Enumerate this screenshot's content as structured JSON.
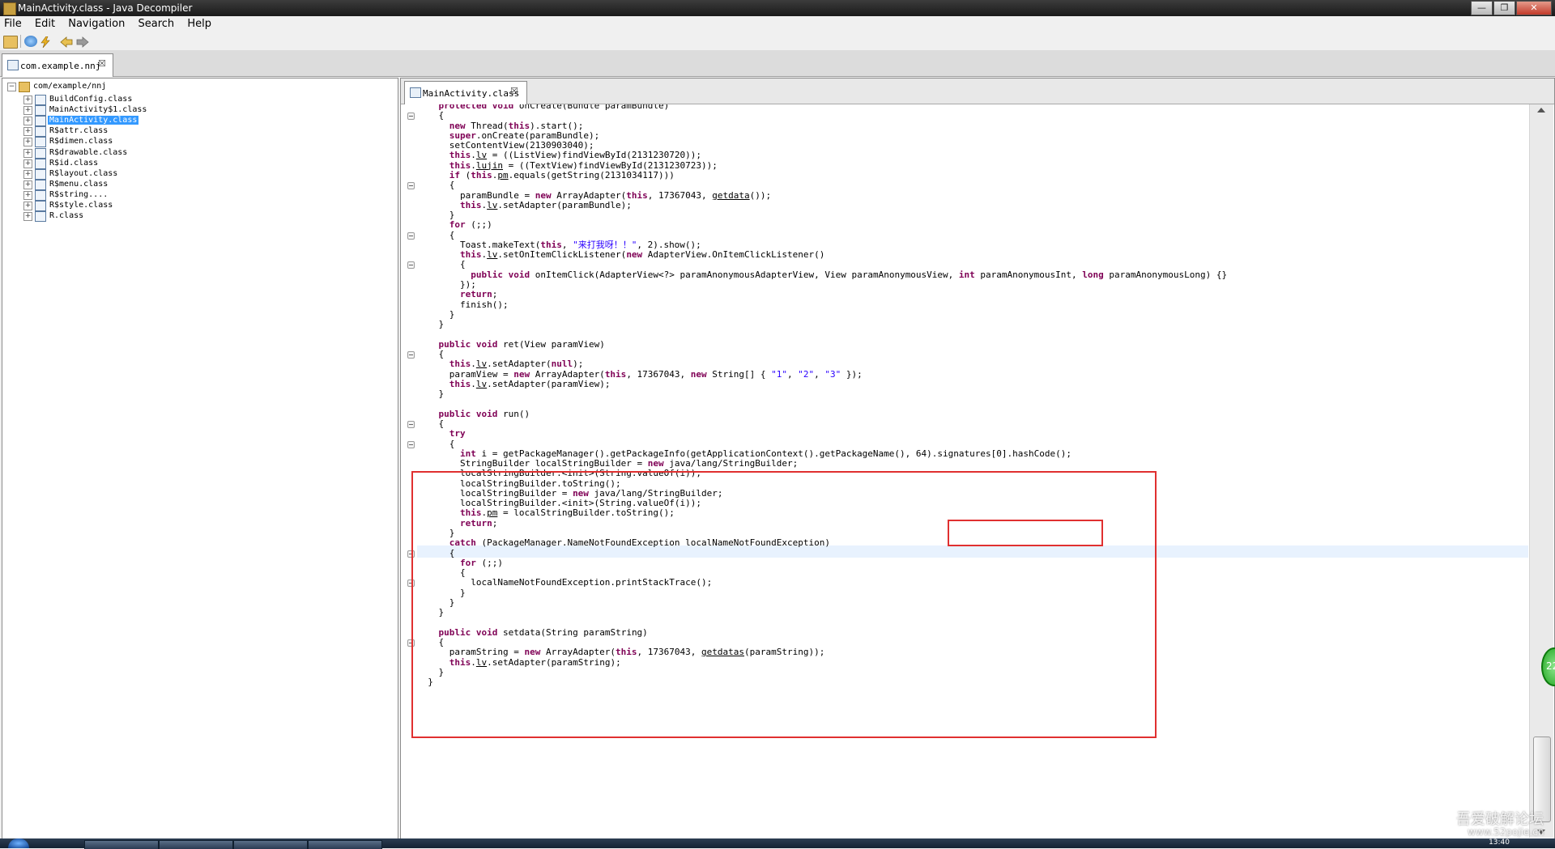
{
  "window": {
    "title": "MainActivity.class - Java Decompiler",
    "buttons": {
      "minimize": "—",
      "maximize": "❐",
      "close": "✕"
    }
  },
  "menubar": [
    "File",
    "Edit",
    "Navigation",
    "Search",
    "Help"
  ],
  "toolbar": {
    "icons": [
      "open-file-icon",
      "open-type-icon",
      "referenced-flash-icon",
      "back-arrow-icon",
      "forward-arrow-icon"
    ]
  },
  "outer_tab": {
    "label": "com.example.nnj",
    "close": "☒"
  },
  "tree": {
    "root": "com/example/nnj",
    "items": [
      "BuildConfig.class",
      "MainActivity$1.class",
      "MainActivity.class",
      "R$attr.class",
      "R$dimen.class",
      "R$drawable.class",
      "R$id.class",
      "R$layout.class",
      "R$menu.class",
      "R$string....",
      "R$style.class",
      "R.class"
    ],
    "selected_index": 2
  },
  "editor_tab": {
    "label": "MainActivity.class",
    "close": "☒"
  },
  "badge_text": "22",
  "watermark": "吾爱破解论坛",
  "watermark_sub": "www.52pojie.cn",
  "taskbar_clock": "13:40",
  "colors": {
    "highlight": "#e03030",
    "keyword": "#7f0055",
    "string": "#2a00ff",
    "selection": "#3399ff"
  }
}
